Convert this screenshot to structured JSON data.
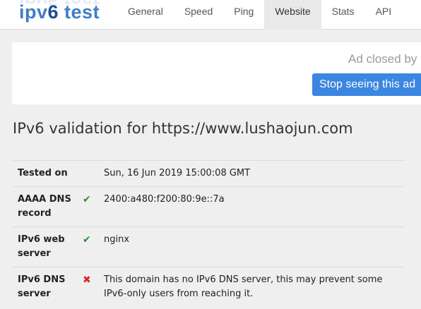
{
  "header": {
    "logo_prefix": "ipv",
    "logo_six": "6",
    "logo_suffix": " test",
    "nav": [
      {
        "label": "General"
      },
      {
        "label": "Speed"
      },
      {
        "label": "Ping"
      },
      {
        "label": "Website",
        "active": true
      },
      {
        "label": "Stats"
      },
      {
        "label": "API"
      }
    ]
  },
  "ad": {
    "closed_text": "Ad closed by",
    "stop_button": "Stop seeing this ad"
  },
  "main": {
    "title": "IPv6 validation for https://www.lushaojun.com",
    "rows": [
      {
        "label_lines": [
          "Tested on"
        ],
        "status": "",
        "status_icon": "none",
        "value": "Sun, 16 Jun 2019 15:00:08 GMT"
      },
      {
        "label_lines": [
          "AAAA DNS",
          "record"
        ],
        "status": "✔",
        "status_icon": "check-icon",
        "value": "2400:a480:f200:80:9e::7a"
      },
      {
        "label_lines": [
          "IPv6 web",
          "server"
        ],
        "status": "✔",
        "status_icon": "check-icon",
        "value": "nginx"
      },
      {
        "label_lines": [
          "IPv6 DNS",
          "server"
        ],
        "status": "✖",
        "status_icon": "cross-icon",
        "value_lines": [
          "This domain has no IPv6 DNS server, this may prevent some",
          "IPv6-only users from reaching it."
        ]
      }
    ]
  },
  "colors": {
    "logo_blue": "#3e7ec6",
    "logo_dark_blue": "#1c4f8e",
    "button_blue": "#3b86e0",
    "ok_green": "#2e8b2e",
    "error_red": "#d42a2a",
    "background": "#efefef"
  }
}
